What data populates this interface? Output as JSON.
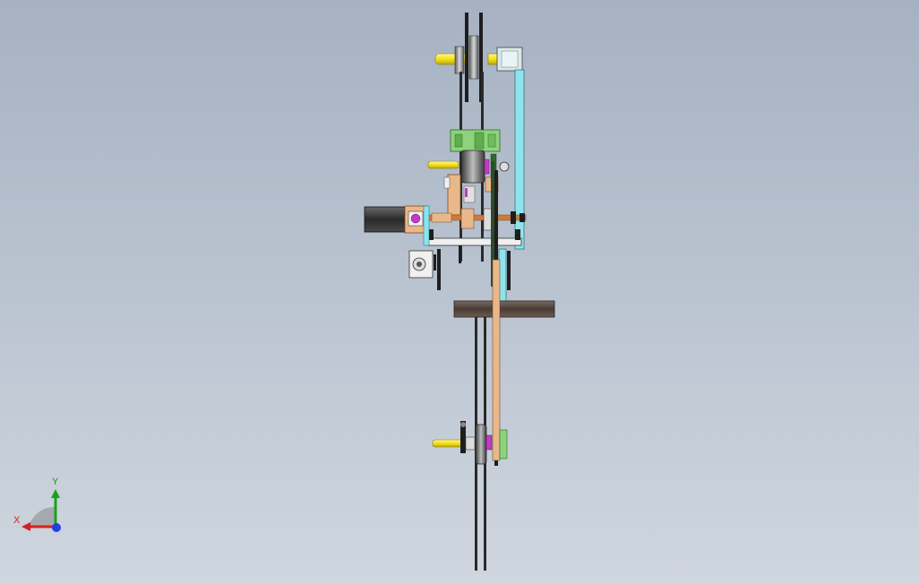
{
  "viewport": {
    "background_top": "#a6b2c2",
    "background_bottom": "#cfd6df"
  },
  "model": {
    "colors": {
      "shaft": "#f2e21c",
      "plate_cyan": "#8ee4ec",
      "wood": "#e9b88a",
      "green": "#8fd27d",
      "magenta": "#c23ac8",
      "dark": "#2b2b2b",
      "brown_bar": "#5a4a42",
      "grey": "#8c8c8c",
      "white": "#f0f0f0"
    }
  },
  "triad": {
    "x_label": "X",
    "y_label": "Y",
    "x_color": "#d62020",
    "y_color": "#17a317",
    "z_color": "#2040e0"
  }
}
